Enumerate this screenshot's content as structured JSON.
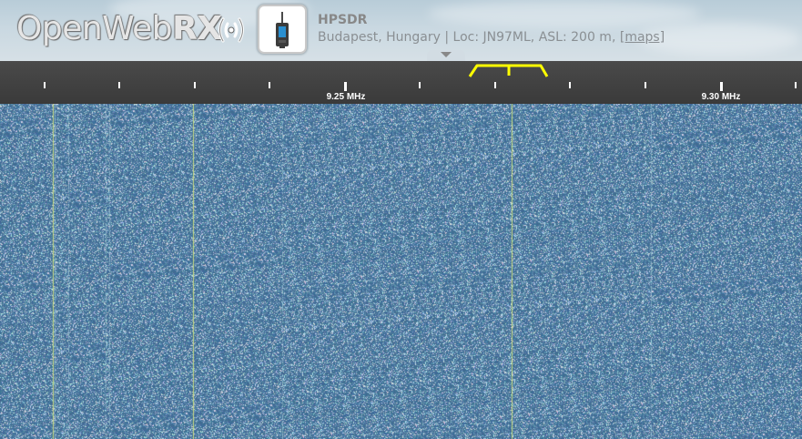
{
  "header": {
    "logo": {
      "part1": "Open",
      "part2": "Web",
      "part3": "RX"
    },
    "receiver": {
      "avatar_icon": "handheld-radio-icon",
      "title": "HPSDR",
      "description": "Budapest, Hungary | Loc: JN97ML, ASL: 200 m,",
      "maps_link": "[maps]"
    },
    "open_panel_icon": "chevron-down-icon"
  },
  "scale": {
    "labels": [
      "9.25 MHz",
      "9.30 MHz"
    ],
    "tick_color": "#ffffff",
    "passband_color": "#ffff00"
  },
  "waterfall": {
    "base_color": "#3f6f90",
    "noise_color": "#c8dde9",
    "signal_color": "#d8e890"
  }
}
